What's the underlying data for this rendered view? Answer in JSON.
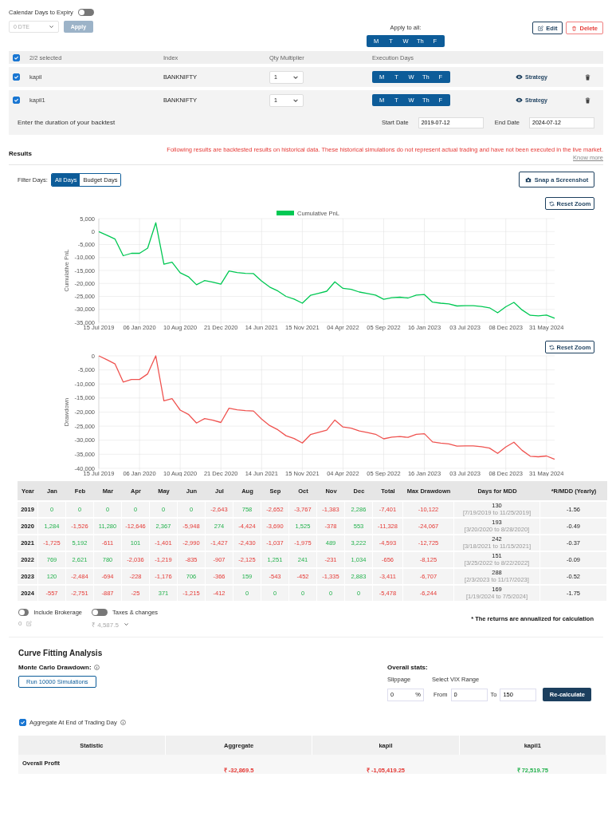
{
  "expiry": {
    "label": "Calendar Days to Expiry",
    "on": false,
    "dte": "0 DTE",
    "apply": "Apply",
    "apply_disabled": true
  },
  "apply_all": {
    "label": "Apply to all:",
    "days": [
      {
        "label": "M",
        "selected": true
      },
      {
        "label": "T",
        "selected": true
      },
      {
        "label": "W",
        "selected": true
      },
      {
        "label": "Th",
        "selected": true
      },
      {
        "label": "F",
        "selected": true
      }
    ]
  },
  "actions": [
    {
      "kind": "edit",
      "label": "Edit"
    },
    {
      "kind": "delete",
      "label": "Delete"
    }
  ],
  "strategies": {
    "all_checked": true,
    "columns": [
      "2/2 selected",
      "Index",
      "Qty Multiplier",
      "Execution Days"
    ],
    "rows": [
      {
        "checked": true,
        "name": "kapil",
        "index": "BANKNIFTY",
        "qty": "1",
        "link": "Strategy",
        "days": [
          {
            "label": "M",
            "selected": true
          },
          {
            "label": "T",
            "selected": true
          },
          {
            "label": "W",
            "selected": true
          },
          {
            "label": "Th",
            "selected": true
          },
          {
            "label": "F",
            "selected": true
          }
        ]
      },
      {
        "checked": true,
        "name": "kapil1",
        "index": "BANKNIFTY",
        "qty": "1",
        "link": "Strategy",
        "days": [
          {
            "label": "M",
            "selected": true
          },
          {
            "label": "T",
            "selected": true
          },
          {
            "label": "W",
            "selected": true
          },
          {
            "label": "Th",
            "selected": true
          },
          {
            "label": "F",
            "selected": true
          }
        ]
      }
    ]
  },
  "duration": {
    "label": "Enter the duration of your backtest",
    "start_label": "Start Date",
    "start": "2019-07-12",
    "end_label": "End Date",
    "end": "2024-07-12"
  },
  "results": {
    "title": "Results",
    "disclaimer": "Following results are backtested results on historical data. These historical simulations do not represent actual trading and have not been executed in the live market.",
    "link": "Know more"
  },
  "filter": {
    "label": "Filter Days:",
    "options": [
      {
        "label": "All Days",
        "selected": true
      },
      {
        "label": "Budget Days",
        "selected": false
      }
    ]
  },
  "screenshot_button": "Snap a Screenshot",
  "charts": [
    {
      "reset": "Reset Zoom",
      "chart_data": {
        "type": "line",
        "grid": true,
        "ylabel": "Cumulative PnL",
        "ylim": [
          -35000,
          5000
        ],
        "categories": [
          "15 Jul 2019",
          null,
          null,
          null,
          null,
          "06 Jan 2020",
          null,
          null,
          null,
          null,
          "10 Aug 2020",
          null,
          null,
          null,
          null,
          "21 Dec 2020",
          null,
          null,
          null,
          null,
          "14 Jun 2021",
          null,
          null,
          null,
          null,
          "15 Nov 2021",
          null,
          null,
          null,
          null,
          "04 Apr 2022",
          null,
          null,
          null,
          null,
          "05 Sep 2022",
          null,
          null,
          null,
          null,
          "16 Jan 2023",
          null,
          null,
          null,
          null,
          "03 Jul 2023",
          null,
          null,
          null,
          null,
          "08 Dec 2023",
          null,
          null,
          null,
          null,
          "31 May 2024",
          null
        ],
        "yticks": [
          {
            "value": 5000,
            "label": "5,000"
          },
          {
            "value": 0,
            "label": "0"
          },
          {
            "value": -5000,
            "label": "-5,000"
          },
          {
            "value": -10000,
            "label": "-10,000"
          },
          {
            "value": -15000,
            "label": "-15,000"
          },
          {
            "value": -20000,
            "label": "-20,000"
          },
          {
            "value": -25000,
            "label": "-25,000"
          },
          {
            "value": -30000,
            "label": "-30,000"
          },
          {
            "value": -35000,
            "label": "-35,000"
          }
        ],
        "series": [
          {
            "name": "Cumulative PnL",
            "color": "#00c853",
            "values": [
              0,
              -1400,
              -2900,
              -9300,
              -8400,
              -8400,
              -6400,
              3400,
              -12600,
              -11800,
              -15900,
              -17400,
              -20500,
              -18900,
              -19500,
              -20300,
              -15200,
              -15800,
              -16100,
              -16200,
              -19100,
              -21400,
              -22900,
              -25000,
              -26000,
              -27600,
              -24600,
              -23800,
              -23000,
              -19400,
              -21900,
              -22300,
              -23300,
              -23900,
              -24500,
              -26100,
              -25500,
              -25300,
              -25600,
              -24500,
              -24300,
              -27200,
              -27600,
              -27900,
              -28700,
              -28600,
              -28600,
              -28900,
              -29400,
              -31300,
              -29000,
              -27300,
              -30200,
              -32300,
              -32500,
              -32200,
              -33400
            ]
          }
        ]
      }
    },
    {
      "reset": "Reset Zoom",
      "chart_data": {
        "type": "line",
        "grid": true,
        "ylabel": "Drawdown",
        "ylim": [
          -40000,
          0
        ],
        "categories": [
          "15 Jul 2019",
          null,
          null,
          null,
          null,
          "06 Jan 2020",
          null,
          null,
          null,
          null,
          "10 Aug 2020",
          null,
          null,
          null,
          null,
          "21 Dec 2020",
          null,
          null,
          null,
          null,
          "14 Jun 2021",
          null,
          null,
          null,
          null,
          "15 Nov 2021",
          null,
          null,
          null,
          null,
          "04 Apr 2022",
          null,
          null,
          null,
          null,
          "05 Sep 2022",
          null,
          null,
          null,
          null,
          "16 Jan 2023",
          null,
          null,
          null,
          null,
          "03 Jul 2023",
          null,
          null,
          null,
          null,
          "08 Dec 2023",
          null,
          null,
          null,
          null,
          "31 May 2024",
          null
        ],
        "yticks": [
          {
            "value": 0,
            "label": "0"
          },
          {
            "value": -5000,
            "label": "-5,000"
          },
          {
            "value": -10000,
            "label": "-10,000"
          },
          {
            "value": -15000,
            "label": "-15,000"
          },
          {
            "value": -20000,
            "label": "-20,000"
          },
          {
            "value": -25000,
            "label": "-25,000"
          },
          {
            "value": -30000,
            "label": "-30,000"
          },
          {
            "value": -35000,
            "label": "-35,000"
          },
          {
            "value": -40000,
            "label": "-40,000"
          }
        ],
        "series": [
          {
            "color": "#ef5350",
            "values": [
              0,
              -1400,
              -2900,
              -9300,
              -8400,
              -8400,
              -6400,
              0,
              -16000,
              -15200,
              -19300,
              -20800,
              -23900,
              -22300,
              -22900,
              -23700,
              -18600,
              -19200,
              -19500,
              -19600,
              -22500,
              -24800,
              -26300,
              -28400,
              -29400,
              -31000,
              -28000,
              -27200,
              -26400,
              -22800,
              -25300,
              -25700,
              -26700,
              -27300,
              -27900,
              -29500,
              -28900,
              -28700,
              -29000,
              -27900,
              -27700,
              -30600,
              -31000,
              -31300,
              -32100,
              -32000,
              -32000,
              -32300,
              -32800,
              -34700,
              -32400,
              -30700,
              -33600,
              -35700,
              -35900,
              -35600,
              -36800
            ]
          }
        ]
      }
    }
  ],
  "monthly": {
    "columns": [
      "Year",
      "Jan",
      "Feb",
      "Mar",
      "Apr",
      "May",
      "Jun",
      "Jul",
      "Aug",
      "Sep",
      "Oct",
      "Nov",
      "Dec",
      "Total",
      "Max Drawdown",
      "Days for MDD",
      "*R/MDD (Yearly)"
    ],
    "rows": [
      {
        "cells": [
          {
            "value": "2019",
            "kind": "year"
          },
          {
            "value": "0",
            "kind": "gain"
          },
          {
            "value": "0",
            "kind": "gain"
          },
          {
            "value": "0",
            "kind": "gain"
          },
          {
            "value": "0",
            "kind": "gain"
          },
          {
            "value": "0",
            "kind": "gain"
          },
          {
            "value": "0",
            "kind": "gain"
          },
          {
            "value": "-2,643",
            "kind": "loss"
          },
          {
            "value": "758",
            "kind": "gain"
          },
          {
            "value": "-2,652",
            "kind": "loss"
          },
          {
            "value": "-3,767",
            "kind": "loss"
          },
          {
            "value": "-1,383",
            "kind": "loss"
          },
          {
            "value": "2,286",
            "kind": "gain"
          },
          {
            "value": "-7,401",
            "kind": "loss"
          },
          {
            "value": "-10,122",
            "kind": "loss"
          },
          {
            "value": "130",
            "note": "[7/19/2019 to 11/25/2019]",
            "kind": "days"
          },
          {
            "value": "-1.56",
            "kind": "ratio"
          }
        ]
      },
      {
        "cells": [
          {
            "value": "2020",
            "kind": "year"
          },
          {
            "value": "1,284",
            "kind": "gain"
          },
          {
            "value": "-1,526",
            "kind": "loss"
          },
          {
            "value": "11,280",
            "kind": "gain"
          },
          {
            "value": "-12,646",
            "kind": "loss"
          },
          {
            "value": "2,367",
            "kind": "gain"
          },
          {
            "value": "-5,948",
            "kind": "loss"
          },
          {
            "value": "274",
            "kind": "gain"
          },
          {
            "value": "-4,424",
            "kind": "loss"
          },
          {
            "value": "-3,690",
            "kind": "loss"
          },
          {
            "value": "1,525",
            "kind": "gain"
          },
          {
            "value": "-378",
            "kind": "loss"
          },
          {
            "value": "553",
            "kind": "gain"
          },
          {
            "value": "-11,328",
            "kind": "loss"
          },
          {
            "value": "-24,067",
            "kind": "loss"
          },
          {
            "value": "193",
            "note": "[3/20/2020 to 8/28/2020]",
            "kind": "days"
          },
          {
            "value": "-0.49",
            "kind": "ratio"
          }
        ]
      },
      {
        "cells": [
          {
            "value": "2021",
            "kind": "year"
          },
          {
            "value": "-1,725",
            "kind": "loss"
          },
          {
            "value": "5,192",
            "kind": "gain"
          },
          {
            "value": "-611",
            "kind": "loss"
          },
          {
            "value": "101",
            "kind": "gain"
          },
          {
            "value": "-1,401",
            "kind": "loss"
          },
          {
            "value": "-2,990",
            "kind": "loss"
          },
          {
            "value": "-1,427",
            "kind": "loss"
          },
          {
            "value": "-2,430",
            "kind": "loss"
          },
          {
            "value": "-1,037",
            "kind": "loss"
          },
          {
            "value": "-1,975",
            "kind": "loss"
          },
          {
            "value": "489",
            "kind": "gain"
          },
          {
            "value": "3,222",
            "kind": "gain"
          },
          {
            "value": "-4,593",
            "kind": "loss"
          },
          {
            "value": "-12,725",
            "kind": "loss"
          },
          {
            "value": "242",
            "note": "[3/18/2021 to 11/15/2021]",
            "kind": "days"
          },
          {
            "value": "-0.37",
            "kind": "ratio"
          }
        ]
      },
      {
        "cells": [
          {
            "value": "2022",
            "kind": "year"
          },
          {
            "value": "769",
            "kind": "gain"
          },
          {
            "value": "2,621",
            "kind": "gain"
          },
          {
            "value": "780",
            "kind": "gain"
          },
          {
            "value": "-2,036",
            "kind": "loss"
          },
          {
            "value": "-1,219",
            "kind": "loss"
          },
          {
            "value": "-835",
            "kind": "loss"
          },
          {
            "value": "-907",
            "kind": "loss"
          },
          {
            "value": "-2,125",
            "kind": "loss"
          },
          {
            "value": "1,251",
            "kind": "gain"
          },
          {
            "value": "241",
            "kind": "gain"
          },
          {
            "value": "-231",
            "kind": "loss"
          },
          {
            "value": "1,034",
            "kind": "gain"
          },
          {
            "value": "-656",
            "kind": "loss"
          },
          {
            "value": "-8,125",
            "kind": "loss"
          },
          {
            "value": "151",
            "note": "[3/25/2022 to 8/22/2022]",
            "kind": "days"
          },
          {
            "value": "-0.09",
            "kind": "ratio"
          }
        ]
      },
      {
        "cells": [
          {
            "value": "2023",
            "kind": "year"
          },
          {
            "value": "120",
            "kind": "gain"
          },
          {
            "value": "-2,484",
            "kind": "loss"
          },
          {
            "value": "-694",
            "kind": "loss"
          },
          {
            "value": "-228",
            "kind": "loss"
          },
          {
            "value": "-1,176",
            "kind": "loss"
          },
          {
            "value": "706",
            "kind": "gain"
          },
          {
            "value": "-366",
            "kind": "loss"
          },
          {
            "value": "159",
            "kind": "gain"
          },
          {
            "value": "-543",
            "kind": "loss"
          },
          {
            "value": "-452",
            "kind": "loss"
          },
          {
            "value": "-1,335",
            "kind": "loss"
          },
          {
            "value": "2,883",
            "kind": "gain"
          },
          {
            "value": "-3,411",
            "kind": "loss"
          },
          {
            "value": "-6,707",
            "kind": "loss"
          },
          {
            "value": "288",
            "note": "[2/3/2023 to 11/17/2023]",
            "kind": "days"
          },
          {
            "value": "-0.52",
            "kind": "ratio"
          }
        ]
      },
      {
        "cells": [
          {
            "value": "2024",
            "kind": "year"
          },
          {
            "value": "-557",
            "kind": "loss"
          },
          {
            "value": "-2,751",
            "kind": "loss"
          },
          {
            "value": "-887",
            "kind": "loss"
          },
          {
            "value": "-25",
            "kind": "loss"
          },
          {
            "value": "371",
            "kind": "gain"
          },
          {
            "value": "-1,215",
            "kind": "loss"
          },
          {
            "value": "-412",
            "kind": "loss"
          },
          {
            "value": "0",
            "kind": "gain"
          },
          {
            "value": "0",
            "kind": "gain"
          },
          {
            "value": "0",
            "kind": "gain"
          },
          {
            "value": "0",
            "kind": "gain"
          },
          {
            "value": "0",
            "kind": "gain"
          },
          {
            "value": "-5,478",
            "kind": "loss"
          },
          {
            "value": "-6,244",
            "kind": "loss"
          },
          {
            "value": "169",
            "note": "[1/19/2024 to 7/5/2024]",
            "kind": "days"
          },
          {
            "value": "-1.75",
            "kind": "ratio"
          }
        ]
      }
    ]
  },
  "costs": {
    "toggles": [
      {
        "label": "Include Brokerage",
        "on": false,
        "value": "0"
      },
      {
        "label": "Taxes & changes",
        "on": false,
        "value": "₹ 4,587.5"
      }
    ],
    "note": "* The returns are annualized for calculation"
  },
  "curve": {
    "title": "Curve Fitting Analysis",
    "monte_title": "Monte Carlo Drawdown:",
    "run": "Run 10000 Simulations",
    "stats_title": "Overall stats:",
    "slippage_label": "Slippage",
    "slippage": "0",
    "percent": "%",
    "vix_label": "Select VIX Range",
    "from_label": "From",
    "from": "0",
    "to_label": "To",
    "to": "150",
    "recalc": "Re-calculate"
  },
  "aggregate": {
    "checked": true,
    "label": "Aggregate At End of Trading Day"
  },
  "stats": {
    "columns": [
      "Statistic",
      "Aggregate",
      "kapil",
      "kapil1"
    ],
    "rows": [
      {
        "label": "Overall Profit",
        "values": [
          {
            "value": "₹ -32,869.5",
            "kind": "loss"
          },
          {
            "value": "₹ -1,05,419.25",
            "kind": "loss"
          },
          {
            "value": "₹ 72,519.75",
            "kind": "gain"
          }
        ]
      }
    ]
  }
}
